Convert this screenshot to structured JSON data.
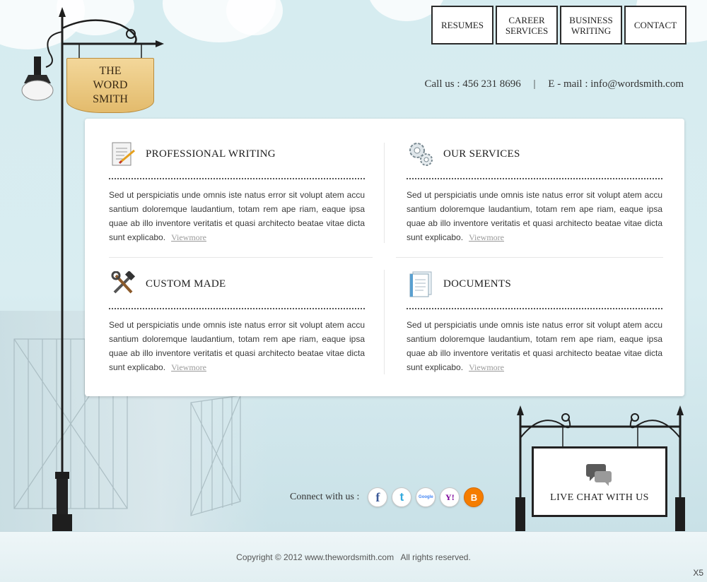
{
  "logo": {
    "line1": "THE",
    "line2": "WORD",
    "line3": "SMITH"
  },
  "nav": {
    "items": [
      {
        "label": "RESUMES"
      },
      {
        "label": "CAREER\nSERVICES"
      },
      {
        "label": "BUSINESS\nWRITING"
      },
      {
        "label": "CONTACT"
      }
    ]
  },
  "contact": {
    "phone": "Call us : 456 231 8696",
    "separator": "|",
    "email": "E - mail : info@wordsmith.com"
  },
  "sections": [
    {
      "title": "PROFESSIONAL WRITING",
      "icon": "document-pencil-icon",
      "text": "Sed ut perspiciatis unde omnis iste natus error sit volupt atem accu santium doloremque laudantium, totam rem ape riam, eaque ipsa quae ab illo inventore veritatis et quasi architecto beatae vitae dicta sunt explicabo.",
      "link": "Viewmore"
    },
    {
      "title": "OUR SERVICES",
      "icon": "gears-icon",
      "text": "Sed ut perspiciatis unde omnis iste natus error sit volupt atem accu santium doloremque laudantium, totam rem ape riam, eaque ipsa quae ab illo inventore veritatis et quasi architecto beatae vitae dicta sunt explicabo.",
      "link": "Viewmore"
    },
    {
      "title": "CUSTOM MADE",
      "icon": "tools-icon",
      "text": "Sed ut perspiciatis unde omnis iste natus error sit volupt atem accu santium doloremque laudantium, totam rem ape riam, eaque ipsa quae ab illo inventore veritatis et quasi architecto beatae vitae dicta sunt explicabo.",
      "link": "Viewmore"
    },
    {
      "title": "DOCUMENTS",
      "icon": "documents-icon",
      "text": "Sed ut perspiciatis unde omnis iste natus error sit volupt atem accu santium doloremque laudantium, totam rem ape riam, eaque ipsa quae ab illo inventore veritatis et quasi architecto beatae vitae dicta sunt explicabo.",
      "link": "Viewmore"
    }
  ],
  "connect": {
    "label": "Connect with us :",
    "networks": [
      {
        "name": "facebook-icon",
        "glyph": "f",
        "color": "#3b5998"
      },
      {
        "name": "twitter-icon",
        "glyph": "t",
        "color": "#33ccff"
      },
      {
        "name": "google-icon",
        "glyph": "Google",
        "color": "#4285f4"
      },
      {
        "name": "yahoo-icon",
        "glyph": "Y!",
        "color": "#7b0099"
      },
      {
        "name": "blogger-icon",
        "glyph": "B",
        "color": "#f57d00"
      }
    ]
  },
  "live_chat": {
    "label": "LIVE CHAT WITH US"
  },
  "footer": {
    "copyright": "Copyright © 2012 www.thewordsmith.com   All rights reserved.",
    "corner": "X5"
  },
  "colors": {
    "sky": "#d7ebef",
    "panel": "#ffffff",
    "sign_wood": "#e9c77f",
    "frame": "#222222"
  }
}
